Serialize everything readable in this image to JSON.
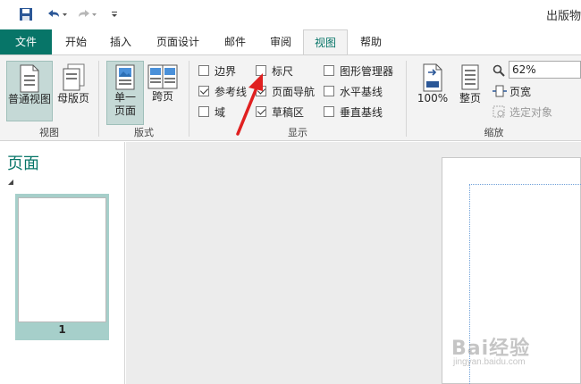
{
  "qat": {
    "save_icon": "save-icon",
    "undo_icon": "undo-icon",
    "redo_icon": "redo-icon",
    "customize_icon": "customize-qat-icon"
  },
  "window": {
    "title": "出版物"
  },
  "tabs": [
    {
      "label": "文件"
    },
    {
      "label": "开始"
    },
    {
      "label": "插入"
    },
    {
      "label": "页面设计"
    },
    {
      "label": "邮件"
    },
    {
      "label": "审阅"
    },
    {
      "label": "视图"
    },
    {
      "label": "帮助"
    }
  ],
  "ribbon": {
    "view_group": {
      "label": "视图",
      "normal_view": "普通视图",
      "master_page": "母版页"
    },
    "layout_group": {
      "label": "版式",
      "single_page": "单一\n页面",
      "two_page": "跨页"
    },
    "show_group": {
      "label": "显示",
      "boundaries": {
        "label": "边界",
        "checked": false
      },
      "guides": {
        "label": "参考线",
        "checked": true
      },
      "fields": {
        "label": "域",
        "checked": false
      },
      "rulers": {
        "label": "标尺",
        "checked": false
      },
      "page_navigation": {
        "label": "页面导航",
        "checked": true
      },
      "scratch_area": {
        "label": "草稿区",
        "checked": true
      },
      "graphics_manager": {
        "label": "图形管理器",
        "checked": false
      },
      "baseline_h": {
        "label": "水平基线",
        "checked": false
      },
      "baseline_v": {
        "label": "垂直基线",
        "checked": false
      }
    },
    "zoom_group": {
      "label": "缩放",
      "percent_100": "100%",
      "whole_page": "整页",
      "zoom_value": "62%",
      "page_width": "页宽",
      "selected_objects": "选定对象"
    }
  },
  "pane": {
    "title": "页面",
    "thumb_number": "1"
  },
  "watermark": {
    "main": "Bai经验",
    "sub": "jingyan.baidu.com"
  },
  "colors": {
    "accent": "#077568",
    "ribbon_bg": "#f3f3f3",
    "workspace_bg": "#ececec",
    "arrow": "#e02020"
  }
}
